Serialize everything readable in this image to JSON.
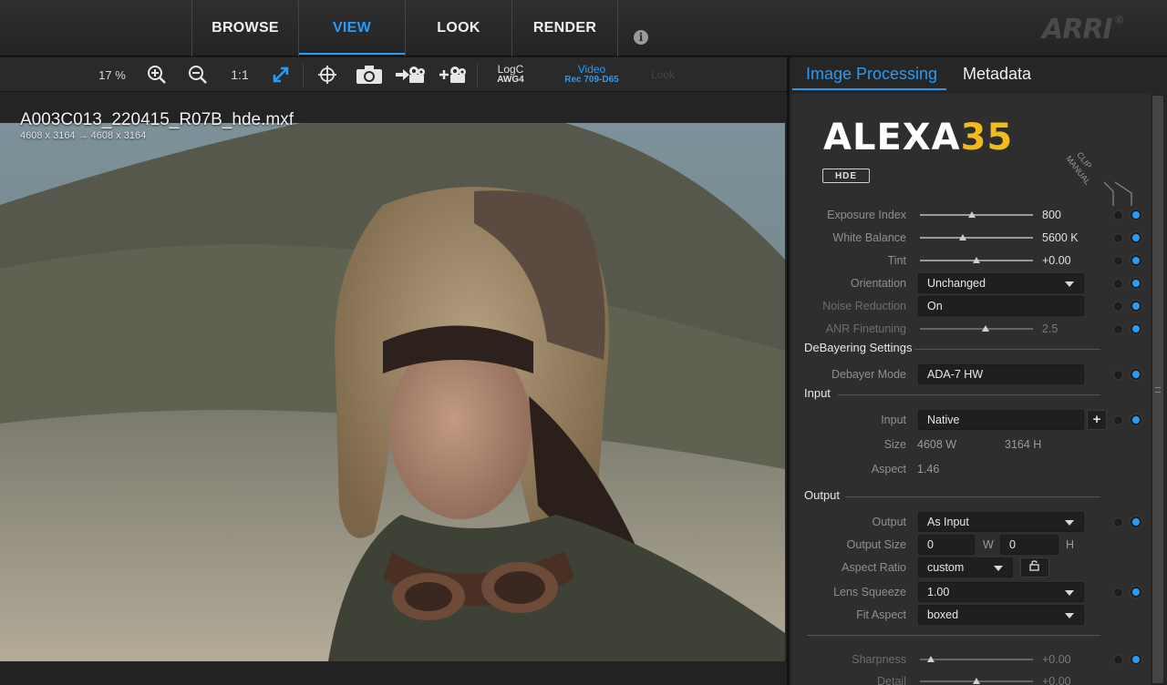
{
  "nav": {
    "items": [
      {
        "label": "BROWSE",
        "active": false
      },
      {
        "label": "VIEW",
        "active": true
      },
      {
        "label": "LOOK",
        "active": false
      },
      {
        "label": "RENDER",
        "active": false
      }
    ],
    "info_icon": "i",
    "logo": "ARRI"
  },
  "toolbar": {
    "zoom": "17 %",
    "one_to_one": "1:1",
    "colorspace_log": {
      "line1": "LogC",
      "line2": "AWG4"
    },
    "colorspace_video": {
      "line1": "Video",
      "line2": "Rec 709-D65"
    },
    "look": "Look",
    "icons": [
      "zoom-in-icon",
      "zoom-out-icon",
      "fit-icon",
      "crosshair-icon",
      "camera-icon",
      "export-film-icon",
      "add-film-icon"
    ]
  },
  "viewer": {
    "clip_name": "A003C013_220415_R07B_hde.mxf",
    "resolution": "4608 x 3164  → 4608 x 3164"
  },
  "panel": {
    "tabs": [
      {
        "label": "Image Processing",
        "active": true
      },
      {
        "label": "Metadata",
        "active": false
      }
    ],
    "camera": {
      "name": "ALEXA",
      "number": "35",
      "badge": "HDE"
    },
    "column_headers": {
      "clip": "CLIP",
      "manual": "MANUAL"
    },
    "params": {
      "exposure_index": {
        "label": "Exposure Index",
        "value": "800",
        "slider": 0.46
      },
      "white_balance": {
        "label": "White Balance",
        "value": "5600 K",
        "slider": 0.38
      },
      "tint": {
        "label": "Tint",
        "value": "+0.00",
        "slider": 0.5
      },
      "orientation": {
        "label": "Orientation",
        "value": "Unchanged"
      },
      "noise_reduction": {
        "label": "Noise Reduction",
        "value": "On"
      },
      "anr_finetuning": {
        "label": "ANR Finetuning",
        "value": "2.5",
        "slider": 0.58
      }
    },
    "debayer": {
      "section": "DeBayering Settings",
      "mode_label": "Debayer Mode",
      "mode_value": "ADA-7 HW"
    },
    "input": {
      "section": "Input",
      "input_label": "Input",
      "input_value": "Native",
      "add_button": "+",
      "size_label": "Size",
      "size_w": "4608 W",
      "size_h": "3164 H",
      "aspect_label": "Aspect",
      "aspect_value": "1.46"
    },
    "output": {
      "section": "Output",
      "output_label": "Output",
      "output_value": "As Input",
      "size_label": "Output Size",
      "size_w": "0",
      "size_w_unit": "W",
      "size_h": "0",
      "size_h_unit": "H",
      "aspect_ratio_label": "Aspect Ratio",
      "aspect_ratio_value": "custom",
      "lens_squeeze_label": "Lens Squeeze",
      "lens_squeeze_value": "1.00",
      "fit_aspect_label": "Fit Aspect",
      "fit_aspect_value": "boxed"
    },
    "sharpness": {
      "label": "Sharpness",
      "value": "+0.00",
      "slider": 0.1
    },
    "detail": {
      "label": "Detail",
      "value": "+0.00",
      "slider": 0.5
    }
  }
}
